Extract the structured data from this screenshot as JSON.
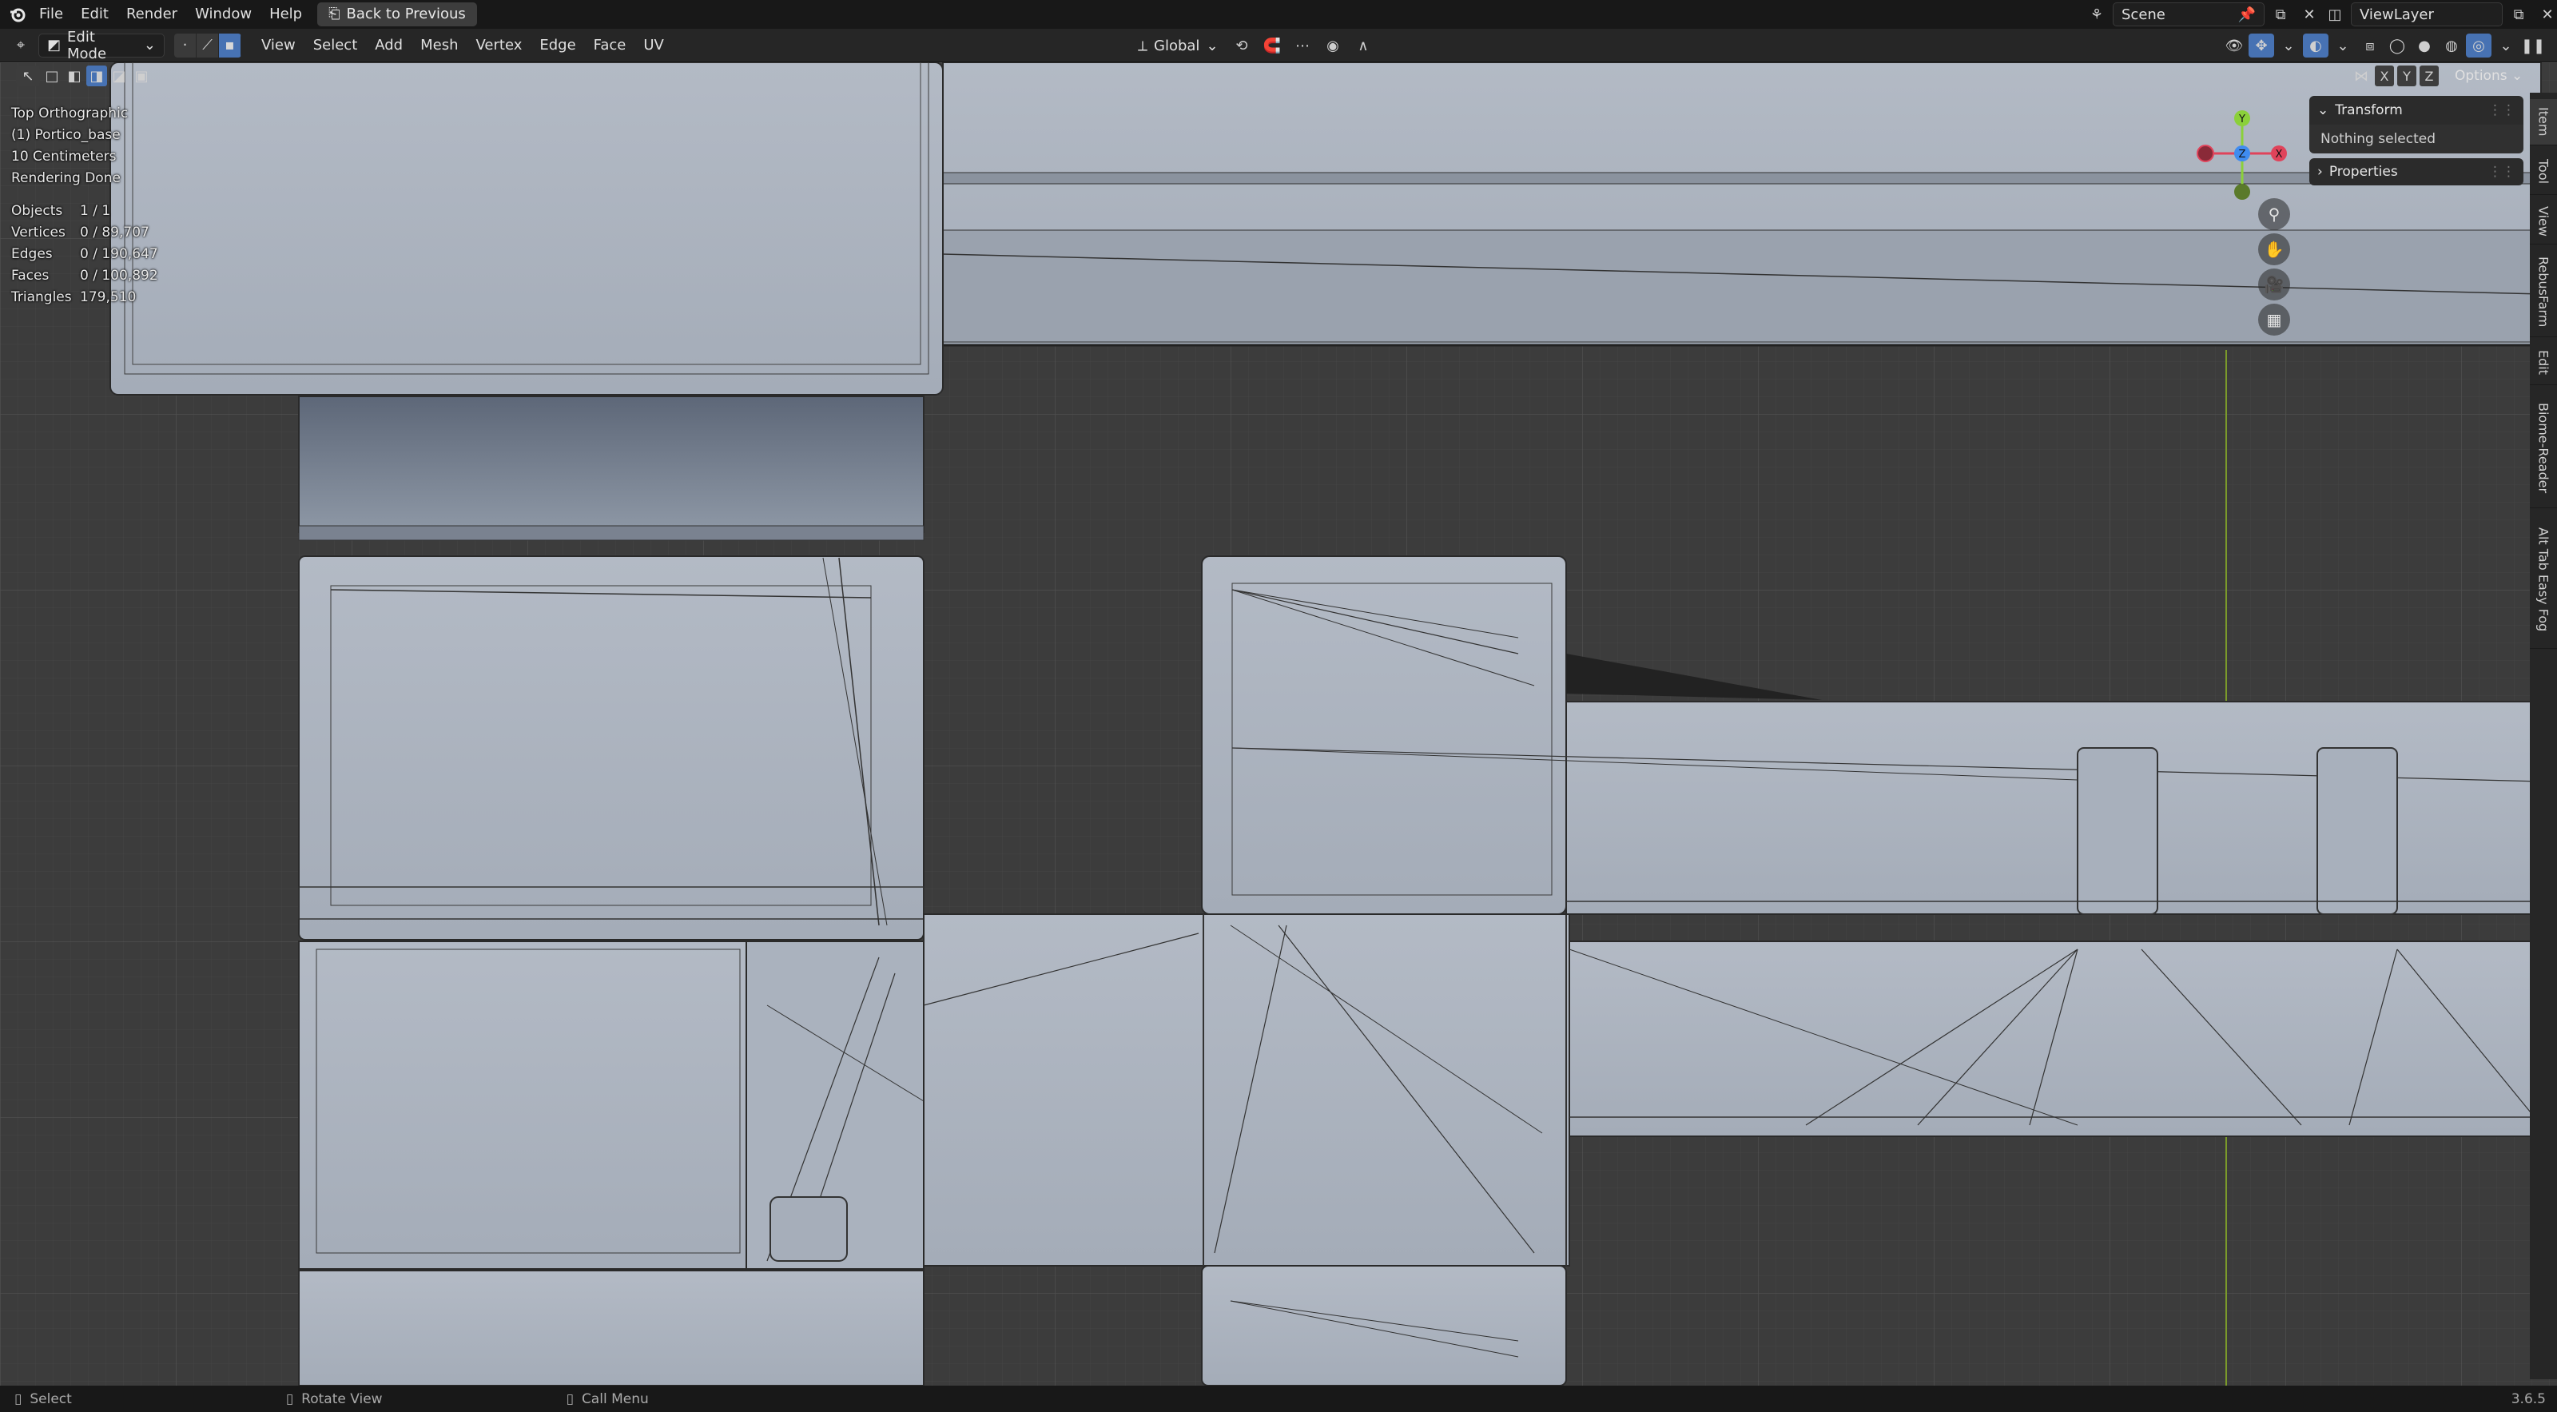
{
  "menubar": {
    "items": [
      "File",
      "Edit",
      "Render",
      "Window",
      "Help"
    ],
    "back_button": "Back to Previous",
    "scene": "Scene",
    "view_layer": "ViewLayer"
  },
  "header": {
    "mode": "Edit Mode",
    "menus": [
      "View",
      "Select",
      "Add",
      "Mesh",
      "Vertex",
      "Edge",
      "Face",
      "UV"
    ],
    "orientation": "Global",
    "axes": [
      "X",
      "Y",
      "Z"
    ],
    "options": "Options"
  },
  "viewport_info": {
    "view": "Top Orthographic",
    "object": "(1) Portico_base",
    "scale": "10 Centimeters",
    "status": "Rendering Done"
  },
  "stats": {
    "rows": [
      {
        "label": "Objects",
        "value": "1 / 1"
      },
      {
        "label": "Vertices",
        "value": "0 / 89,707"
      },
      {
        "label": "Edges",
        "value": "0 / 190,647"
      },
      {
        "label": "Faces",
        "value": "0 / 100,892"
      },
      {
        "label": "Triangles",
        "value": "179,510"
      }
    ]
  },
  "gizmo": {
    "y": "Y",
    "z": "Z",
    "x": "X"
  },
  "n_panel": {
    "transform_title": "Transform",
    "transform_body": "Nothing selected",
    "properties_title": "Properties"
  },
  "side_tabs": [
    "Item",
    "Tool",
    "View",
    "RebusFarm",
    "Edit",
    "Biome-Reader",
    "Alt Tab Easy Fog"
  ],
  "statusbar": {
    "select": "Select",
    "rotate": "Rotate View",
    "call_menu": "Call Menu",
    "version": "3.6.5"
  },
  "colors": {
    "accent": "#4772b3",
    "mesh_fill": "#a9b1bd",
    "grid_bg": "#3c3c3c",
    "axis_x": "#e0435a",
    "axis_y": "#8bd03a",
    "axis_z": "#3f8cf0"
  }
}
